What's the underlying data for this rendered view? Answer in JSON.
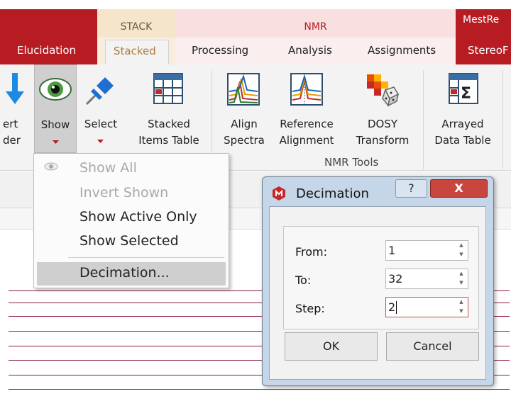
{
  "contextual_tabs": {
    "stack": "STACK",
    "nmr": "NMR",
    "mestre": "MestRe"
  },
  "tabs": [
    "Elucidation",
    "Stacked",
    "Processing",
    "Analysis",
    "Assignments",
    "StereoF"
  ],
  "ribbon": {
    "buttons": {
      "insert_order": [
        "ert",
        "der"
      ],
      "show": "Show",
      "select": "Select",
      "stacked_items_table": [
        "Stacked",
        "Items Table"
      ],
      "align_spectra": [
        "Align",
        "Spectra"
      ],
      "reference_alignment": [
        "Reference",
        "Alignment"
      ],
      "dosy_transform": [
        "DOSY",
        "Transform"
      ],
      "arrayed_data_table": [
        "Arrayed",
        "Data Table"
      ]
    },
    "group_label": "NMR Tools"
  },
  "show_menu": {
    "items": [
      "Show All",
      "Invert Shown",
      "Show Active Only",
      "Show Selected",
      "Decimation..."
    ]
  },
  "dialog": {
    "title": "Decimation",
    "help_symbol": "?",
    "close_symbol": "X",
    "fields": [
      {
        "label": "From:",
        "value": "1"
      },
      {
        "label": "To:",
        "value": "32"
      },
      {
        "label": "Step:",
        "value": "2"
      }
    ],
    "ok_label": "OK",
    "cancel_label": "Cancel"
  },
  "colors": {
    "accent_red": "#b71c23",
    "stack_context": "#f5e6cb",
    "nmr_context": "#f8e0e0",
    "spectrum_line": "#8b1c3a"
  }
}
